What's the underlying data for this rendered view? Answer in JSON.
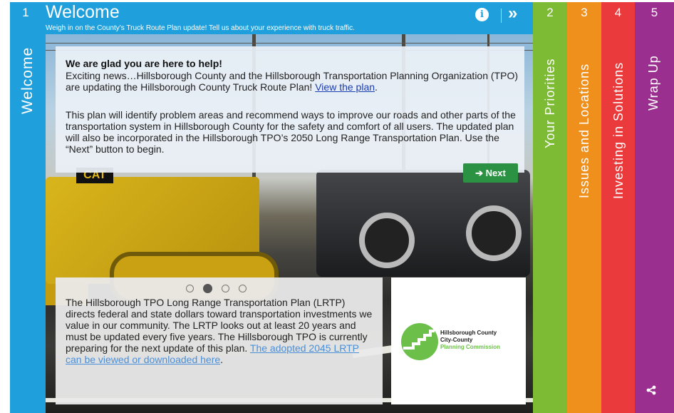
{
  "active_step": {
    "number": "1",
    "label": "Welcome",
    "title": "Welcome",
    "subtitle": "Weigh in on the County’s Truck Route Plan update! Tell us about your experience with truck traffic."
  },
  "header": {
    "info_icon": "info-circle-icon",
    "next_icon": "double-chevron-right-icon"
  },
  "intro_card": {
    "heading": "We are glad you are here to help!",
    "para1": "Exciting news…Hillsborough County and the Hillsborough Transportation Planning Organization (TPO) are updating the Hillsborough County Truck Route Plan! ",
    "para1_link": "View the plan",
    "para1_end": ".",
    "para2": "This plan will identify problem areas and recommend ways to improve our roads and other parts of the transportation system in Hillsborough County for the safety and comfort of all users. The updated plan will also be incorporated in the Hillsborough TPO’s 2050 Long Range Transportation Plan. Use the “Next” button to begin.",
    "next_button": "Next"
  },
  "bottom_card": {
    "text": "The Hillsborough TPO Long Range Transportation Plan (LRTP) directs federal and state dollars toward transportation investments we value in our community. The LRTP looks out at least 20 years and must be updated every five years. The Hillsborough TPO is currently preparing for the next update of this plan. ",
    "link": "The adopted 2045 LRTP can be viewed or downloaded here",
    "end": ".",
    "carousel_dots": 4,
    "active_dot": 2
  },
  "logo": {
    "line1": "Hillsborough County",
    "line2": "City-County",
    "line3": "Planning Commission"
  },
  "tabs": [
    {
      "number": "2",
      "label": "Your Priorities",
      "color": "#7dbb35"
    },
    {
      "number": "3",
      "label": "Issues and Locations",
      "color": "#f0901c"
    },
    {
      "number": "4",
      "label": "Investing in Solutions",
      "color": "#ea3a3c"
    },
    {
      "number": "5",
      "label": "Wrap Up",
      "color": "#9a2f90"
    }
  ],
  "share_icon": "share-icon"
}
